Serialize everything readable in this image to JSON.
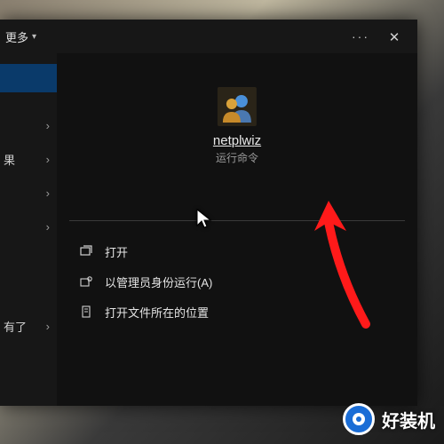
{
  "titlebar": {
    "more_label": "更多",
    "ellipsis": "···"
  },
  "sidebar": {
    "items": [
      {
        "label": ""
      },
      {
        "label": "果"
      },
      {
        "label": ""
      },
      {
        "label": ""
      }
    ],
    "bottom_label": "有了"
  },
  "detail": {
    "app_name": "netplwiz",
    "app_subtitle": "运行命令",
    "actions": [
      {
        "label": "打开"
      },
      {
        "label": "以管理员身份运行(A)"
      },
      {
        "label": "打开文件所在的位置"
      }
    ]
  },
  "watermark": {
    "text": "好装机"
  }
}
